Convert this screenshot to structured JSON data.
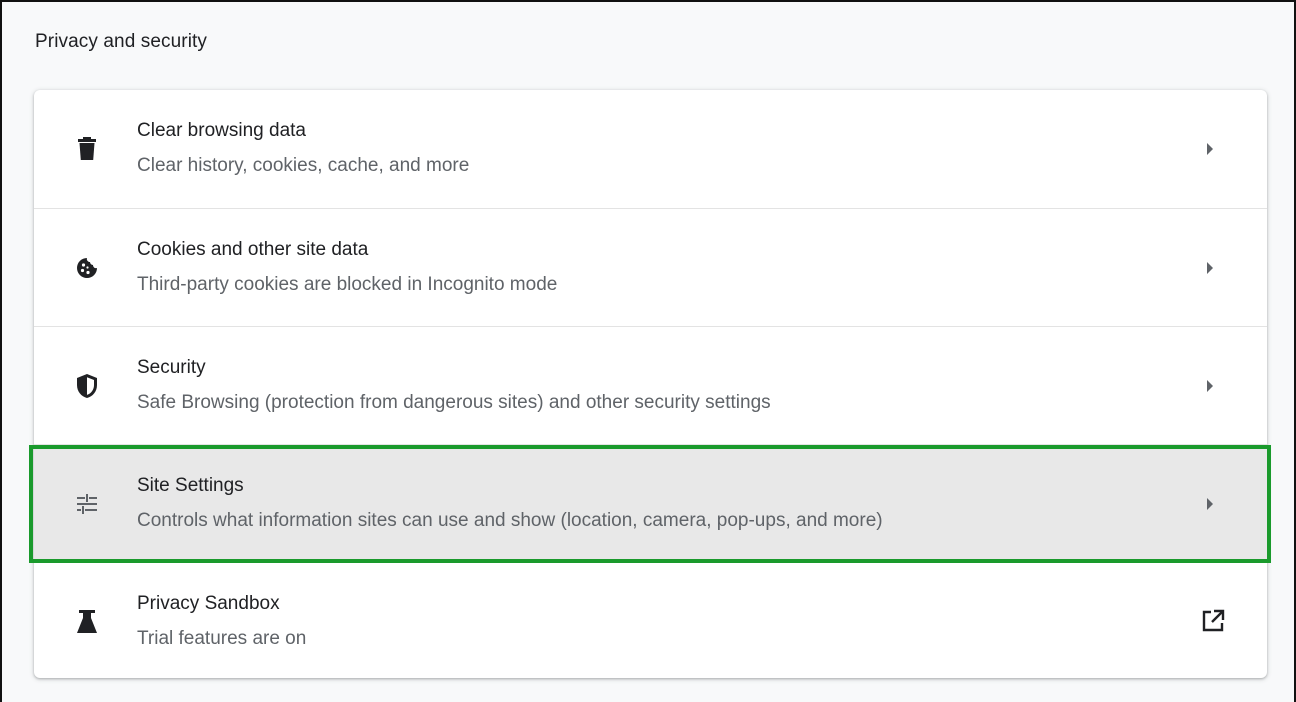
{
  "section": {
    "title": "Privacy and security"
  },
  "items": [
    {
      "icon": "trash-icon",
      "title": "Clear browsing data",
      "subtitle": "Clear history, cookies, cache, and more",
      "action": "chevron-right-icon"
    },
    {
      "icon": "cookie-icon",
      "title": "Cookies and other site data",
      "subtitle": "Third-party cookies are blocked in Incognito mode",
      "action": "chevron-right-icon"
    },
    {
      "icon": "shield-icon",
      "title": "Security",
      "subtitle": "Safe Browsing (protection from dangerous sites) and other security settings",
      "action": "chevron-right-icon"
    },
    {
      "icon": "tune-sliders-icon",
      "title": "Site Settings",
      "subtitle": "Controls what information sites can use and show (location, camera, pop-ups, and more)",
      "action": "chevron-right-icon",
      "highlighted": true
    },
    {
      "icon": "flask-icon",
      "title": "Privacy Sandbox",
      "subtitle": "Trial features are on",
      "action": "open-in-new-icon"
    }
  ],
  "colors": {
    "highlight_border": "#1a9a2c",
    "highlight_bg": "#e8e8e8",
    "icon": "#202124",
    "chevron": "#5f6368"
  }
}
